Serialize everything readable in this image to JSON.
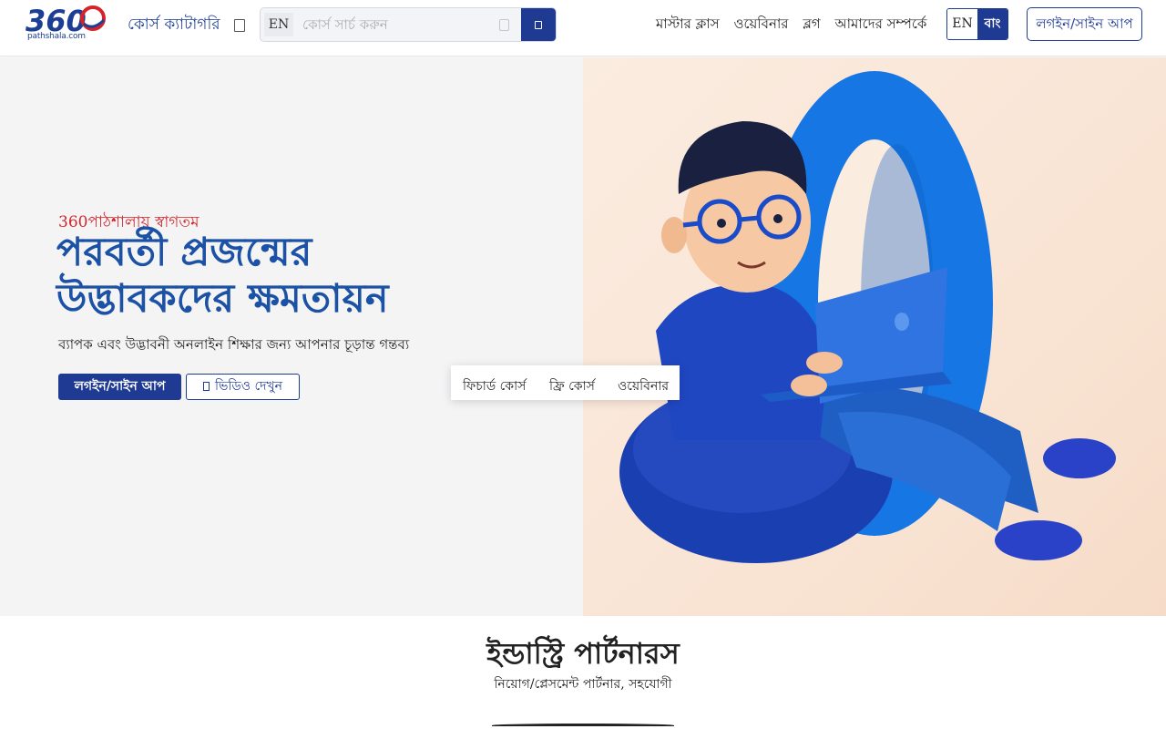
{
  "header": {
    "logo_text": "360",
    "logo_sub": "pathshala.com",
    "course_category": "কোর্স ক্যাটাগরি",
    "search": {
      "lang": "EN",
      "placeholder": "কোর্স সার্চ করুন"
    },
    "nav": [
      "মাস্টার ক্লাস",
      "ওয়েবিনার",
      "ব্লগ",
      "আমাদের সম্পর্কে"
    ],
    "lang_toggle": {
      "en": "EN",
      "bn": "বাং",
      "active": "bn"
    },
    "login_label": "লগইন/সাইন আপ"
  },
  "hero": {
    "welcome": "360পাঠশালায় স্বাগতম",
    "headline_line1": "পরবর্তী প্রজন্মের",
    "headline_line2": "উদ্ভাবকদের ক্ষমতায়ন",
    "subline": "ব্যাপক এবং উদ্ভাবনী অনলাইন শিক্ষার জন্য আপনার চূড়ান্ত গন্তব্য",
    "login_button": "লগইন/সাইন আপ",
    "video_button": "ভিডিও দেখুন",
    "tabs": [
      "ফিচার্ড কোর্স",
      "ফ্রি কোর্স",
      "ওয়েবিনার"
    ]
  },
  "partners": {
    "title": "ইন্ডাস্ট্রি পার্টনারস",
    "subtitle": "নিয়োগ/প্লেসমেন্ট পার্টনার, সহযোগী"
  },
  "colors": {
    "brand_blue": "#1f3a93",
    "headline_blue": "#1c52a6",
    "welcome_red": "#d3242a",
    "hero_left_bg": "#f4f4f5",
    "hero_right_bg": "#fbece0"
  }
}
